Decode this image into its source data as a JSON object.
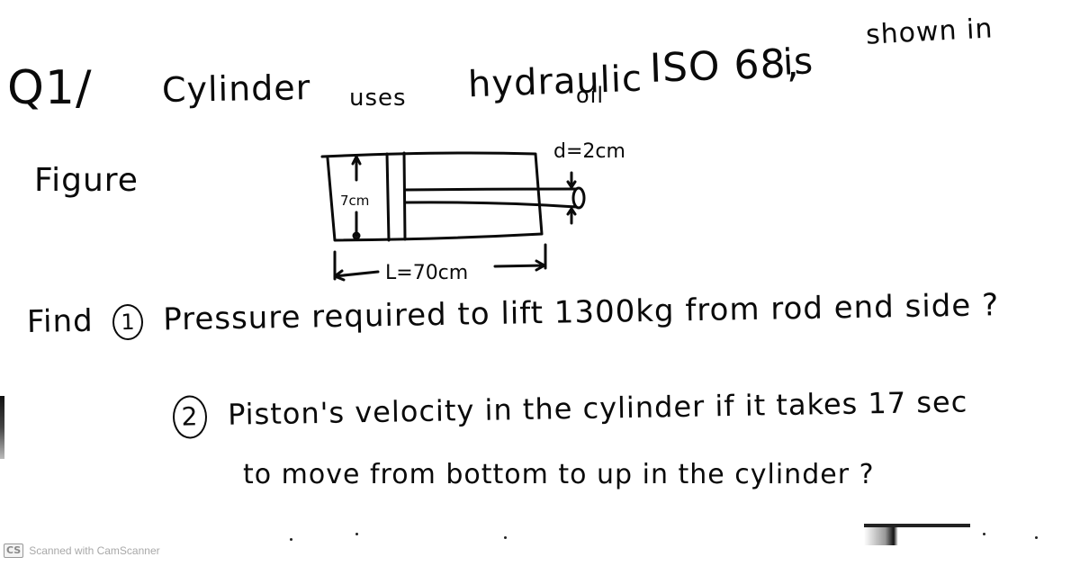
{
  "question": {
    "label": "Q1/",
    "intro_parts": [
      "Cylinder",
      "uses",
      "hydraulic",
      "oil",
      "ISO 68",
      ",",
      "is",
      "shown in"
    ],
    "figure_label": "Figure"
  },
  "diagram": {
    "bore_label": "7cm",
    "rod_label": "d=2cm",
    "length_label": "L=70cm"
  },
  "tasks": [
    {
      "number": "1",
      "prefix": "Find",
      "text": "Pressure required to lift 1300kg from rod end side ?"
    },
    {
      "number": "2",
      "text_line1": "Piston's velocity in the cylinder if it takes 17 sec",
      "text_line2": "to move from bottom to up in the cylinder ?"
    }
  ],
  "watermark": {
    "logo": "CS",
    "text": "Scanned with CamScanner"
  }
}
